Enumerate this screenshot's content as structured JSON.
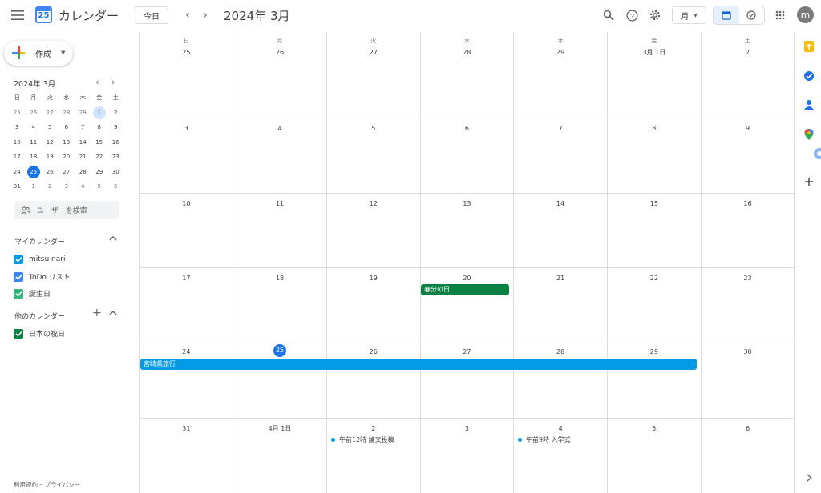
{
  "header": {
    "app_name": "カレンダー",
    "logo_number": "25",
    "today_label": "今日",
    "month_title": "2024年 3月",
    "view_label": "月",
    "avatar_letter": "m"
  },
  "sidebar": {
    "create_label": "作成",
    "mini_title": "2024年 3月",
    "mini_dow": [
      "日",
      "月",
      "火",
      "水",
      "木",
      "金",
      "土"
    ],
    "mini_weeks": [
      [
        "25",
        "26",
        "27",
        "28",
        "29",
        "1",
        "2"
      ],
      [
        "3",
        "4",
        "5",
        "6",
        "7",
        "8",
        "9"
      ],
      [
        "10",
        "11",
        "12",
        "13",
        "14",
        "15",
        "16"
      ],
      [
        "17",
        "18",
        "19",
        "20",
        "21",
        "22",
        "23"
      ],
      [
        "24",
        "25",
        "26",
        "27",
        "28",
        "29",
        "30"
      ],
      [
        "31",
        "1",
        "2",
        "3",
        "4",
        "5",
        "6"
      ]
    ],
    "people_search_placeholder": "ユーザーを検索",
    "my_calendars_title": "マイカレンダー",
    "my_calendars": [
      {
        "label": "mitsu nari",
        "color": "#039be5"
      },
      {
        "label": "ToDo リスト",
        "color": "#4285f4"
      },
      {
        "label": "誕生日",
        "color": "#33b679"
      }
    ],
    "other_calendars_title": "他のカレンダー",
    "other_calendars": [
      {
        "label": "日本の祝日",
        "color": "#0b8043"
      }
    ],
    "footer": "利用規約 – プライバシー"
  },
  "month": {
    "dow": [
      "日",
      "月",
      "火",
      "水",
      "木",
      "金",
      "土"
    ],
    "weeks": [
      [
        "25",
        "26",
        "27",
        "28",
        "29",
        "3月 1日",
        "2"
      ],
      [
        "3",
        "4",
        "5",
        "6",
        "7",
        "8",
        "9"
      ],
      [
        "10",
        "11",
        "12",
        "13",
        "14",
        "15",
        "16"
      ],
      [
        "17",
        "18",
        "19",
        "20",
        "21",
        "22",
        "23"
      ],
      [
        "24",
        "25",
        "26",
        "27",
        "28",
        "29",
        "30"
      ],
      [
        "31",
        "4月 1日",
        "2",
        "3",
        "4",
        "5",
        "6"
      ]
    ],
    "today": "25",
    "events": {
      "shunbun": {
        "label": "春分の日",
        "color": "#0b8043"
      },
      "trip": {
        "label": "宮崎県旅行",
        "color": "#039be5"
      },
      "paper": {
        "label": "午前12時 論文投稿",
        "color": "#039be5"
      },
      "ceremony": {
        "label": "午前9時 入学式",
        "color": "#039be5"
      }
    }
  }
}
